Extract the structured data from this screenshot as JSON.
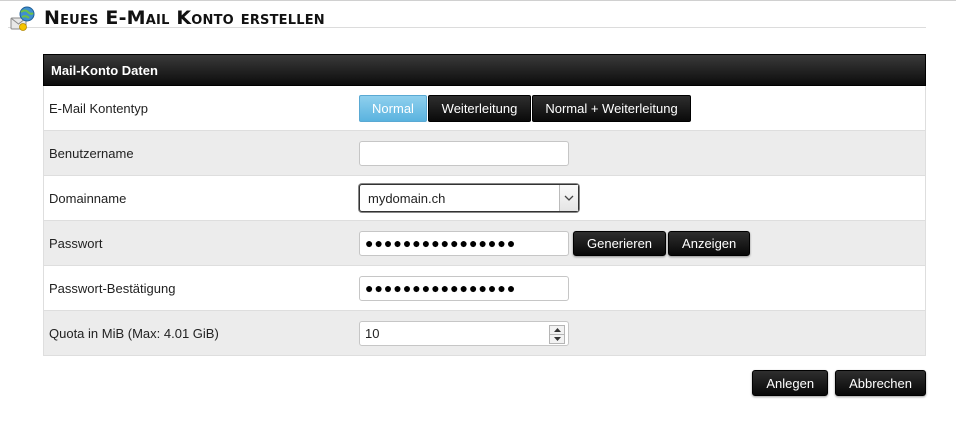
{
  "page": {
    "title": "Neues E-Mail Konto erstellen",
    "icon": "mail-account-icon"
  },
  "panel": {
    "header": "Mail-Konto Daten"
  },
  "form": {
    "account_type": {
      "label": "E-Mail Kontentyp",
      "options": [
        "Normal",
        "Weiterleitung",
        "Normal + Weiterleitung"
      ],
      "selected": "Normal"
    },
    "username": {
      "label": "Benutzername",
      "value": ""
    },
    "domain": {
      "label": "Domainname",
      "value": "mydomain.ch"
    },
    "password": {
      "label": "Passwort",
      "value": "●●●●●●●●●●●●●●●●",
      "generate_label": "Generieren",
      "show_label": "Anzeigen"
    },
    "password_confirm": {
      "label": "Passwort-Bestätigung",
      "value": "●●●●●●●●●●●●●●●●"
    },
    "quota": {
      "label": "Quota in MiB (Max: 4.01 GiB)",
      "value": "10"
    }
  },
  "actions": {
    "create_label": "Anlegen",
    "cancel_label": "Abbrechen"
  },
  "colors": {
    "active_segment": "#5ab3df",
    "dark_button": "#0a0a0a"
  }
}
